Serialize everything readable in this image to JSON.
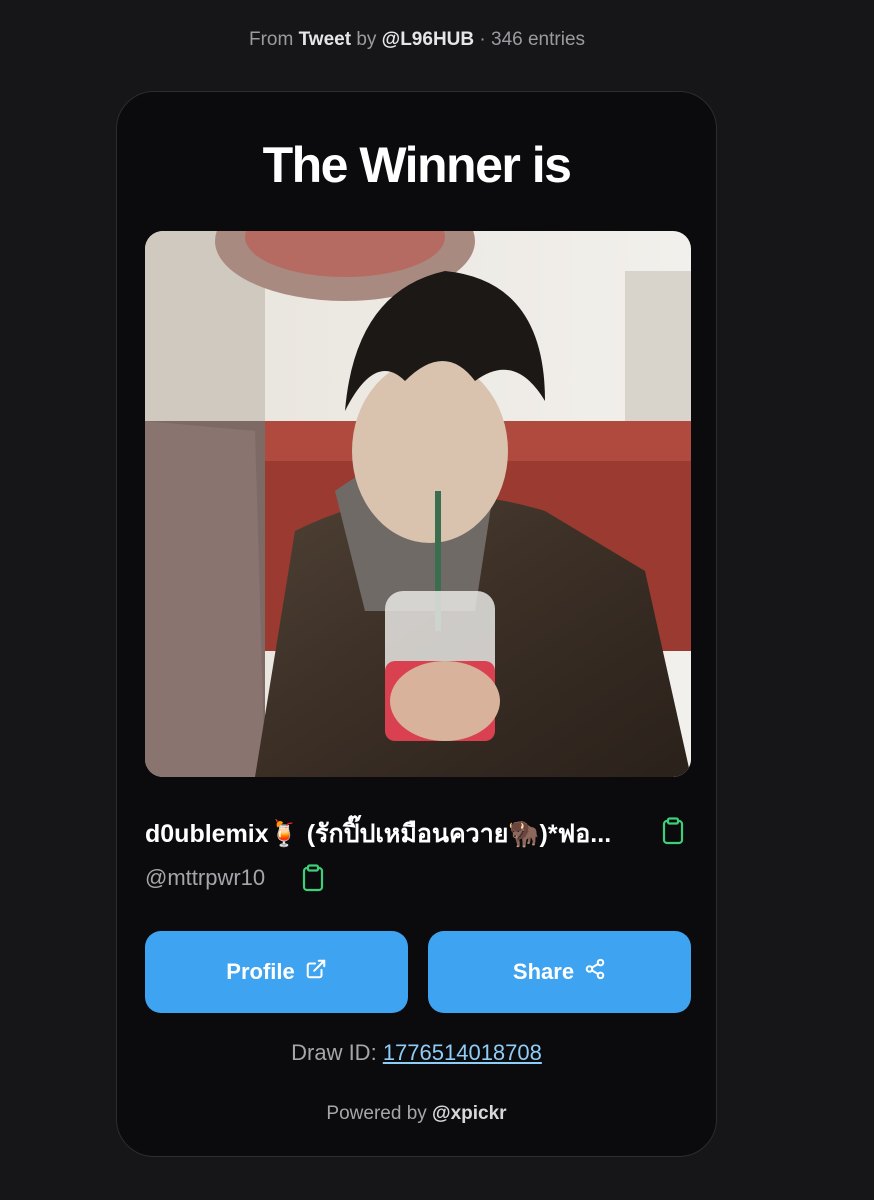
{
  "header": {
    "from_text": "From",
    "source_type": "Tweet",
    "by_text": "by",
    "author": "@L96HUB",
    "separator": "·",
    "entries": "346 entries"
  },
  "card": {
    "title": "The Winner is",
    "winner_photo_icon": "winner-photo",
    "winner_name": "d0ublemix🍹 (รักปิ๊ปเหมือนควาย🦬)*ฟอ...",
    "winner_handle": "@mttrpwr10",
    "copy_icon": "clipboard-icon",
    "profile_label": "Profile",
    "profile_icon": "external-link-icon",
    "share_label": "Share",
    "share_icon": "share-icon",
    "draw_id_label": "Draw ID:",
    "draw_id_value": "1776514018708",
    "powered_by_label": "Powered by",
    "powered_by_brand": "@xpickr"
  },
  "colors": {
    "background": "#161618",
    "card": "#0b0b0d",
    "accent_button": "#3ea3f0",
    "link": "#8ecdf7",
    "copy_icon": "#3ecf7a"
  }
}
